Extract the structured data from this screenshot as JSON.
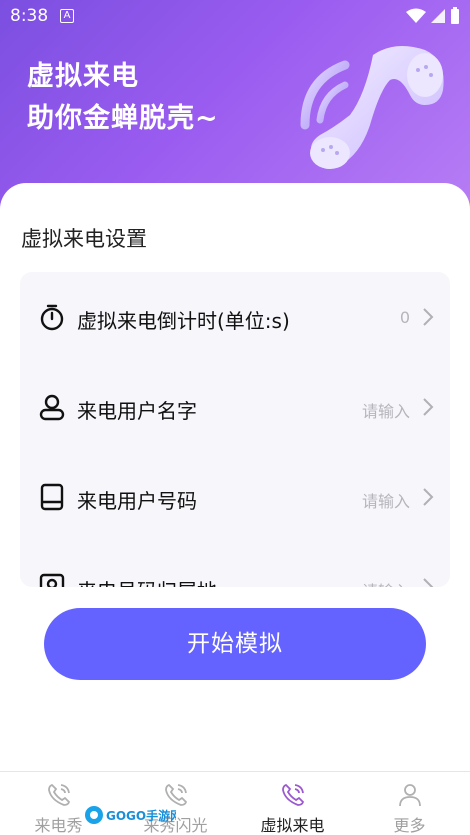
{
  "status_bar": {
    "time": "8:38",
    "badge": "A"
  },
  "hero": {
    "line1": "虚拟来电",
    "line2": "助你金蝉脱壳~"
  },
  "section_title": "虚拟来电设置",
  "settings": [
    {
      "label": "虚拟来电倒计时(单位:s)",
      "value": "0",
      "icon": "timer-icon"
    },
    {
      "label": "来电用户名字",
      "value": "请输入",
      "icon": "user-icon"
    },
    {
      "label": "来电用户号码",
      "value": "请输入",
      "icon": "phone-device-icon"
    },
    {
      "label": "来电号码归属地",
      "value": "请输入",
      "icon": "location-card-icon"
    }
  ],
  "start_button": "开始模拟",
  "nav": [
    {
      "label": "来电秀",
      "icon": "phone-ring-icon",
      "active": false
    },
    {
      "label": "来秀闪光",
      "icon": "phone-ring-icon",
      "active": false
    },
    {
      "label": "虚拟来电",
      "icon": "phone-ring-icon",
      "active": true
    },
    {
      "label": "更多",
      "icon": "person-icon",
      "active": false
    }
  ],
  "watermark": "GOGO手游网",
  "colors": {
    "accent": "#6563ff",
    "hero_start": "#7b4fe0",
    "hero_end": "#b77df5",
    "active_icon": "#9b59d0"
  }
}
